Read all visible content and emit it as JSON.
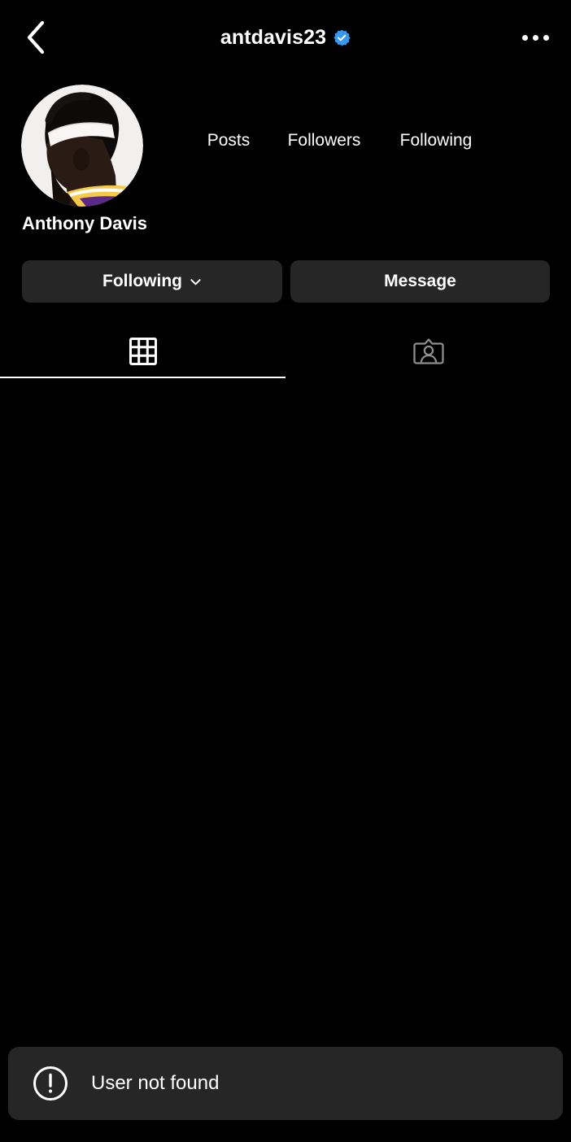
{
  "app": "instagram-profile",
  "theme": {
    "background": "#000000",
    "surface": "#262626",
    "text_primary": "#ffffff",
    "text_secondary": "#a8a8a8",
    "verified_blue": "#3897F0"
  },
  "navbar": {
    "back_icon": "chevron-left-icon",
    "username": "antdavis23",
    "verified_badge_icon": "verified-badge-icon",
    "more_icon": "more-options-icon"
  },
  "profile": {
    "avatar_icon": "profile-avatar",
    "full_name": "Anthony Davis",
    "stats": [
      {
        "key": "posts",
        "count": "",
        "label": "Posts"
      },
      {
        "key": "followers",
        "count": "",
        "label": "Followers"
      },
      {
        "key": "following",
        "count": "",
        "label": "Following"
      }
    ]
  },
  "actions": {
    "following_label": "Following",
    "following_chevron_icon": "chevron-down-icon",
    "message_label": "Message"
  },
  "tabs": [
    {
      "key": "grid",
      "icon": "grid-icon",
      "active": true
    },
    {
      "key": "tagged",
      "icon": "tagged-person-icon",
      "active": false
    }
  ],
  "toast": {
    "icon": "error-exclamation-icon",
    "message": "User not found"
  }
}
